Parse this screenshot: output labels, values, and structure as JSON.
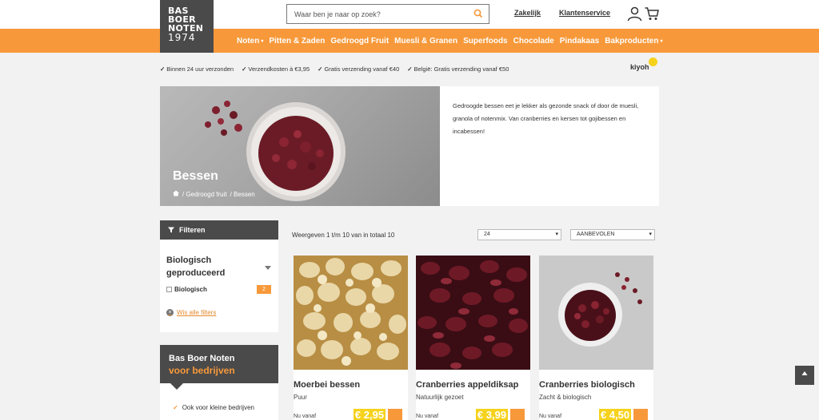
{
  "header": {
    "logo": {
      "line1": "BAS",
      "line2": "BOER",
      "line3": "NOTEN",
      "year": "1974"
    },
    "search_placeholder": "Waar ben je naar op zoek?",
    "links": {
      "business": "Zakelijk",
      "service": "Klantenservice"
    },
    "icons": {
      "search": "search-icon",
      "user": "user-icon",
      "cart": "cart-icon"
    }
  },
  "nav": {
    "items": [
      "Noten",
      "Pitten & Zaden",
      "Gedroogd Fruit",
      "Muesli & Granen",
      "Superfoods",
      "Chocolade",
      "Pindakaas",
      "Bakproducten"
    ],
    "caret": "▾"
  },
  "usps": [
    "Binnen 24 uur verzonden",
    "Verzendkosten à €3,95",
    "Gratis verzending vanaf €40",
    "België: Gratis verzending vanaf €50"
  ],
  "usp_check": "✓",
  "kiyoh": "kiyoh",
  "category": {
    "title": "Bessen",
    "breadcrumbs": [
      "/ Gedroogd fruit",
      "/ Bessen"
    ],
    "description": "Gedroogde bessen eet je lekker als gezonde snack of door de muesli, granola of notenmix. Van cranberries en kersen tot gojibessen en incabessen!"
  },
  "sidebar": {
    "filter_header": "Filteren",
    "filter_group": "Biologisch geproduceerd",
    "facets": [
      {
        "label": "Biologisch",
        "count": "2"
      }
    ],
    "clear_label": "Wis alle filters",
    "business": {
      "line1": "Bas Boer Noten",
      "line2": "voor bedrijven",
      "bullet": "Ook voor kleine bedrijven"
    }
  },
  "listing": {
    "result_count": "Weergeven 1 t/m 10 van in totaal 10",
    "per_page": "24",
    "sort": "AANBEVOLEN",
    "products": [
      {
        "name": "Moerbei bessen",
        "subtitle": "Puur",
        "from": "Nu vanaf",
        "price": "€ 2,95"
      },
      {
        "name": "Cranberries appeldiksap",
        "subtitle": "Natuurlijk gezoet",
        "from": "Nu vanaf",
        "price": "€ 3,99"
      },
      {
        "name": "Cranberries biologisch",
        "subtitle": "Zacht & biologisch",
        "from": "Nu vanaf",
        "price": "€ 4,50"
      }
    ]
  },
  "colors": {
    "accent": "#f7993a",
    "dark": "#4a4a4a",
    "price": "#f6d21c"
  }
}
